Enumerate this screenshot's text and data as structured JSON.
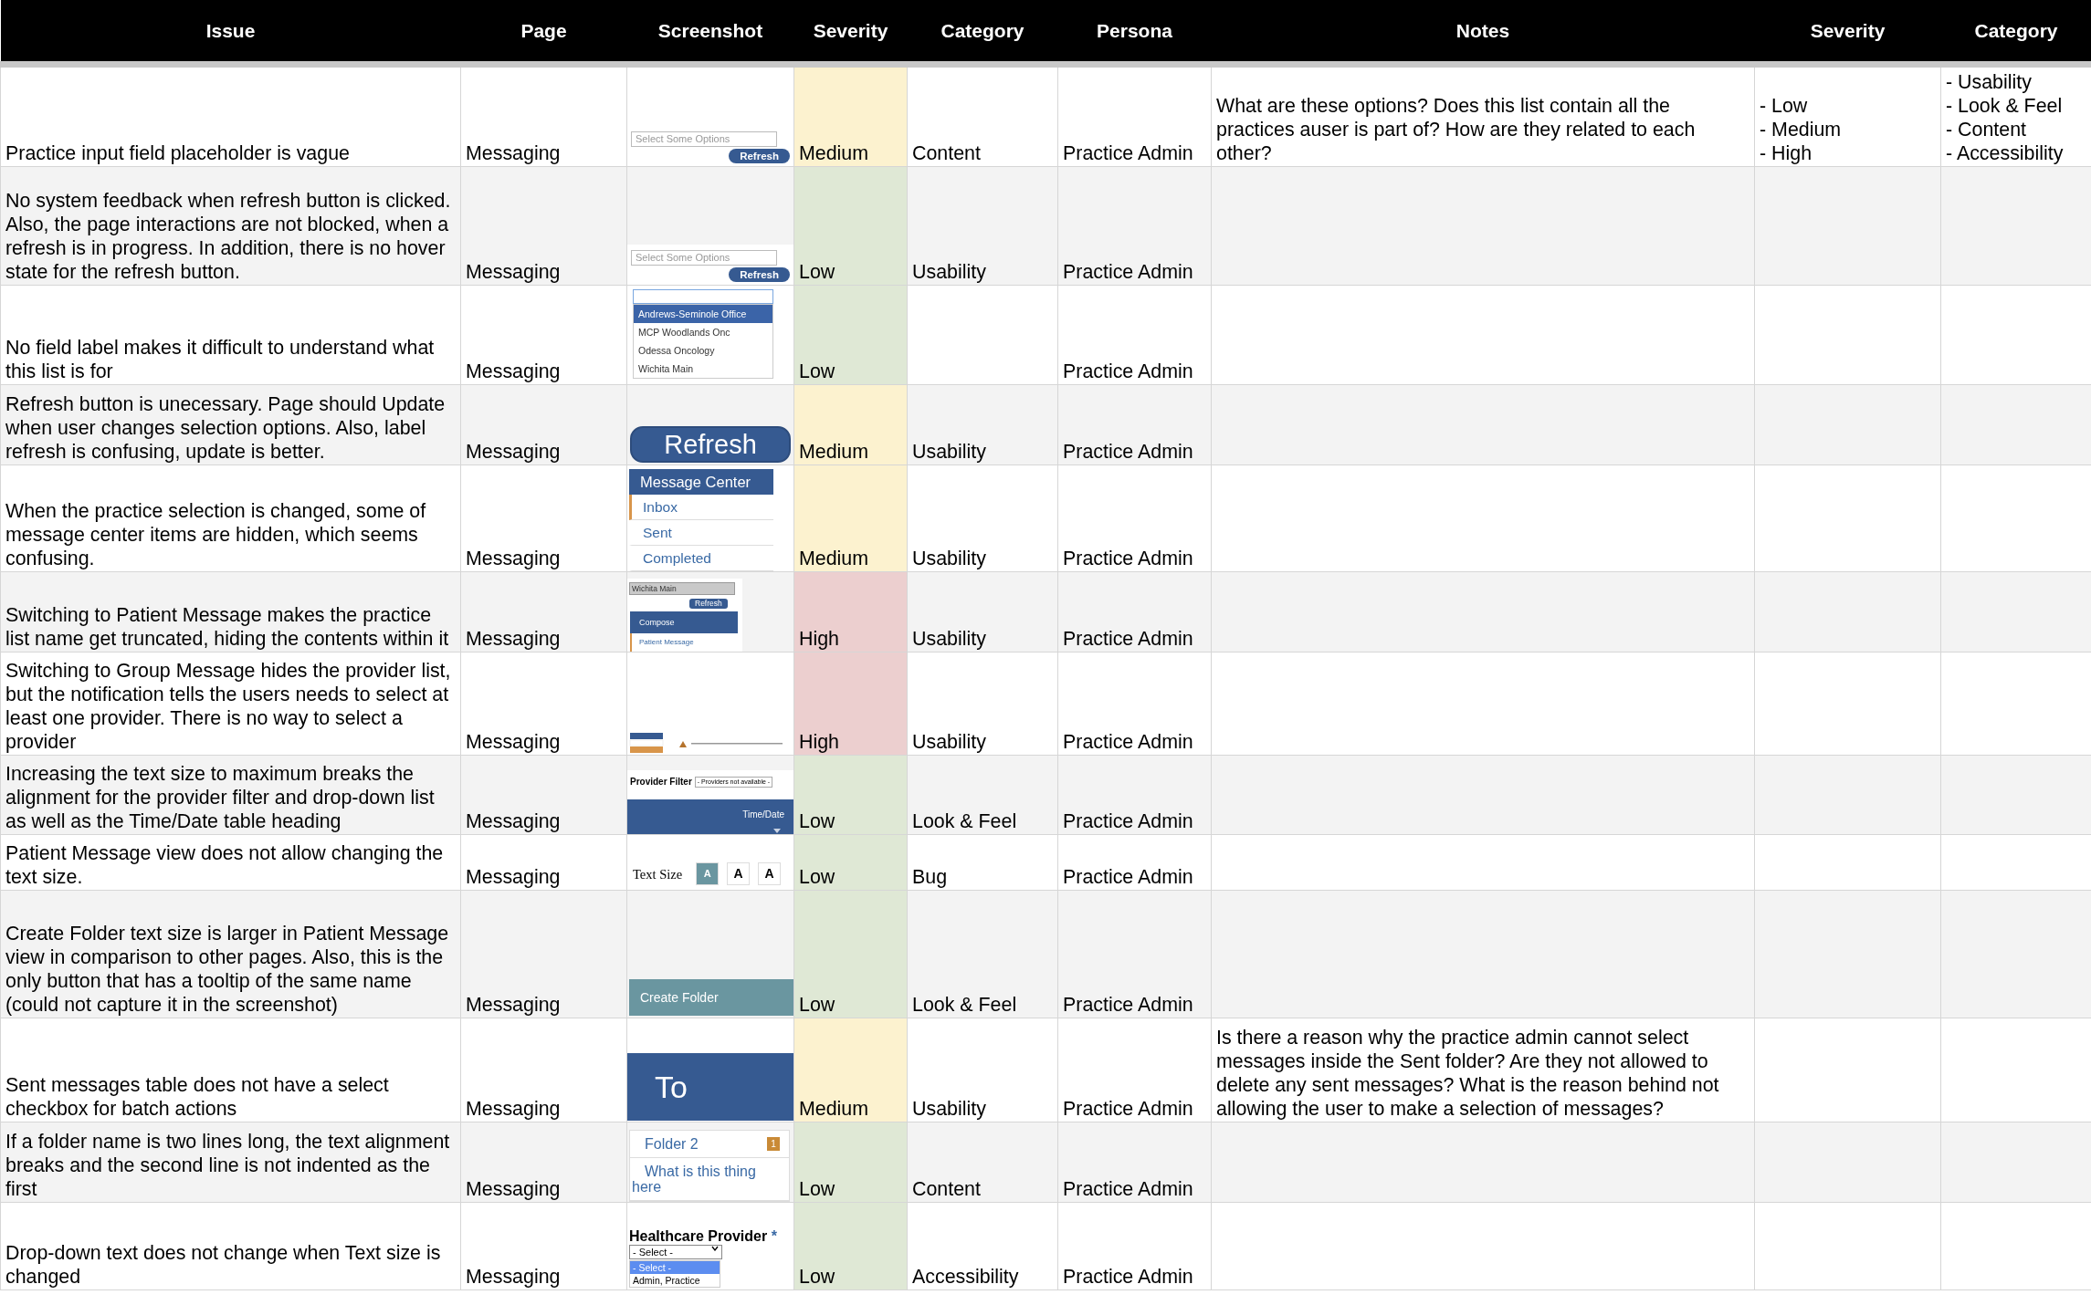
{
  "columns": [
    "Issue",
    "Page",
    "Screenshot",
    "Severity",
    "Category",
    "Persona",
    "Notes",
    "Severity",
    "Category"
  ],
  "rows": [
    {
      "issue": "Practice input field placeholder is vague",
      "page": "Messaging",
      "screenshot": {
        "kind": "select_refresh",
        "placeholder": "Select Some Options",
        "button": "Refresh"
      },
      "severity": {
        "text": "Medium",
        "color": "#fcf2cf"
      },
      "category": "Content",
      "persona": "Practice Admin",
      "notes": "What are these options? Does this list contain all the practices auser is part of? How are they related to each other?",
      "severity_options": [
        "- Low",
        "- Medium",
        "- High"
      ],
      "category_options": [
        "- Usability",
        "- Look & Feel",
        "- Content",
        "- Accessibility"
      ]
    },
    {
      "issue": "No system feedback when refresh button is clicked. Also, the page interactions are not blocked, when a refresh is in progress. In addition, there is no hover state for the refresh button.",
      "page": "Messaging",
      "screenshot": {
        "kind": "select_refresh",
        "placeholder": "Select Some Options",
        "button": "Refresh"
      },
      "severity": {
        "text": "Low",
        "color": "#dfe8d5"
      },
      "category": "Usability",
      "persona": "Practice Admin"
    },
    {
      "issue": "No field label makes it difficult to understand what this list is for",
      "page": "Messaging",
      "screenshot": {
        "kind": "dropdown",
        "options": [
          {
            "label": "Andrews-Seminole Office",
            "selected": true
          },
          {
            "label": "MCP Woodlands Onc",
            "selected": false
          },
          {
            "label": "Odessa Oncology",
            "selected": false
          },
          {
            "label": "Wichita Main",
            "selected": false
          }
        ]
      },
      "severity": {
        "text": "Low",
        "color": "#dfe8d5"
      },
      "persona": "Practice Admin"
    },
    {
      "issue": "Refresh button is unecessary. Page should Update when user changes selection options. Also, label refresh is confusing, update is better.",
      "page": "Messaging",
      "screenshot": {
        "kind": "big_button",
        "label": "Refresh"
      },
      "severity": {
        "text": "Medium",
        "color": "#fcf2cf"
      },
      "category": "Usability",
      "persona": "Practice Admin"
    },
    {
      "issue": "When the practice selection is changed, some of message center items are hidden, which seems confusing.",
      "page": "Messaging",
      "screenshot": {
        "kind": "nav",
        "header": "Message Center",
        "items": [
          {
            "label": "Inbox",
            "selected": true
          },
          {
            "label": "Sent",
            "selected": false
          },
          {
            "label": "Completed",
            "selected": false
          }
        ]
      },
      "severity": {
        "text": "Medium",
        "color": "#fcf2cf"
      },
      "category": "Usability",
      "persona": "Practice Admin"
    },
    {
      "issue": "Switching to Patient Message makes the practice list name get truncated, hiding the contents within it",
      "page": "Messaging",
      "screenshot": {
        "kind": "compose",
        "select": "Wichita Main",
        "button": "Refresh",
        "header": "Compose",
        "items": [
          {
            "label": "Patient Message",
            "selected": true
          }
        ]
      },
      "severity": {
        "text": "High",
        "color": "#eccfcf"
      },
      "category": "Usability",
      "persona": "Practice Admin"
    },
    {
      "issue": "Switching to Group Message hides the provider list, but the notification tells the users needs to select at least one provider. There is no way to select a provider",
      "page": "Messaging",
      "screenshot": {
        "kind": "mini_screen"
      },
      "severity": {
        "text": "High",
        "color": "#eccfcf"
      },
      "category": "Usability",
      "persona": "Practice Admin"
    },
    {
      "issue": "Increasing the text size to maximum breaks the alignment for the provider filter and drop-down list as well as the Time/Date table heading",
      "page": "Messaging",
      "screenshot": {
        "kind": "filter",
        "label": "Provider Filter",
        "select": "- Providers not available -",
        "column": "Time/Date"
      },
      "severity": {
        "text": "Low",
        "color": "#dfe8d5"
      },
      "category": "Look & Feel",
      "persona": "Practice Admin"
    },
    {
      "issue": "Patient Message view does not allow changing the text size.",
      "page": "Messaging",
      "screenshot": {
        "kind": "text_size",
        "label": "Text Size",
        "buttons": [
          {
            "label": "A",
            "selected": true
          },
          {
            "label": "A",
            "selected": false
          },
          {
            "label": "A",
            "selected": false
          }
        ]
      },
      "severity": {
        "text": "Low",
        "color": "#dfe8d5"
      },
      "category": "Bug",
      "persona": "Practice Admin"
    },
    {
      "issue": "Create Folder text size is larger in Patient Message view in comparison to other pages. Also, this is the only button that has a tooltip of the same name (could not capture it in the screenshot)",
      "page": "Messaging",
      "screenshot": {
        "kind": "wide_button",
        "label": "Create Folder"
      },
      "severity": {
        "text": "Low",
        "color": "#dfe8d5"
      },
      "category": "Look & Feel",
      "persona": "Practice Admin"
    },
    {
      "issue": "Sent messages table does not have a select checkbox for batch actions",
      "page": "Messaging",
      "screenshot": {
        "kind": "header",
        "label": "To"
      },
      "severity": {
        "text": "Medium",
        "color": "#fcf2cf"
      },
      "category": "Usability",
      "persona": "Practice Admin",
      "notes": "Is there a reason why the practice admin cannot select messages inside the Sent folder? Are they not allowed to delete any sent messages? What is the reason behind not allowing the user to make a selection of messages?"
    },
    {
      "issue": "If a folder name is two lines long, the text alignment breaks and the second line is not indented as the first",
      "page": "Messaging",
      "screenshot": {
        "kind": "folders",
        "items": [
          {
            "label": "Folder 2",
            "badge": "1"
          },
          {
            "label": "What is this thing here"
          }
        ]
      },
      "severity": {
        "text": "Low",
        "color": "#dfe8d5"
      },
      "category": "Content",
      "persona": "Practice Admin"
    },
    {
      "issue": "Drop-down text does not change when Text size is changed",
      "page": "Messaging",
      "screenshot": {
        "kind": "provider_select",
        "label": "Healthcare Provider",
        "required": "*",
        "select": "- Select -",
        "options": [
          {
            "label": "- Select -",
            "selected": true
          },
          {
            "label": "Admin, Practice",
            "selected": false
          }
        ]
      },
      "severity": {
        "text": "Low",
        "color": "#dfe8d5"
      },
      "category": "Accessibility",
      "persona": "Practice Admin"
    }
  ]
}
